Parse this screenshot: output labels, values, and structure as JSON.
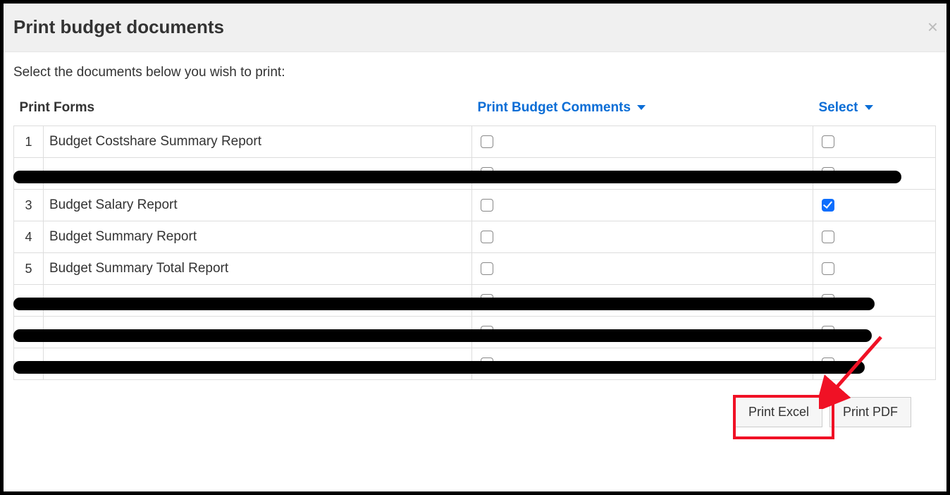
{
  "modal": {
    "title": "Print budget documents",
    "close_label": "×",
    "instructions": "Select the documents below you wish to print:"
  },
  "headers": {
    "forms": "Print Forms",
    "comments": "Print Budget Comments",
    "select": "Select"
  },
  "rows": [
    {
      "num": "1",
      "name": "Budget Costshare Summary Report",
      "comments_checked": false,
      "select_checked": false,
      "redacted": false
    },
    {
      "num": "",
      "name": "",
      "comments_checked": false,
      "select_checked": false,
      "redacted": true
    },
    {
      "num": "3",
      "name": "Budget Salary Report",
      "comments_checked": false,
      "select_checked": true,
      "redacted": false
    },
    {
      "num": "4",
      "name": "Budget Summary Report",
      "comments_checked": false,
      "select_checked": false,
      "redacted": false
    },
    {
      "num": "5",
      "name": "Budget Summary Total Report",
      "comments_checked": false,
      "select_checked": false,
      "redacted": false
    },
    {
      "num": "",
      "name": "",
      "comments_checked": false,
      "select_checked": false,
      "redacted": true
    },
    {
      "num": "",
      "name": "",
      "comments_checked": false,
      "select_checked": false,
      "redacted": true
    },
    {
      "num": "",
      "name": "",
      "comments_checked": false,
      "select_checked": false,
      "redacted": true
    }
  ],
  "buttons": {
    "print_excel": "Print Excel",
    "print_pdf": "Print PDF"
  },
  "annotation": {
    "highlight_target": "print-excel-button"
  }
}
